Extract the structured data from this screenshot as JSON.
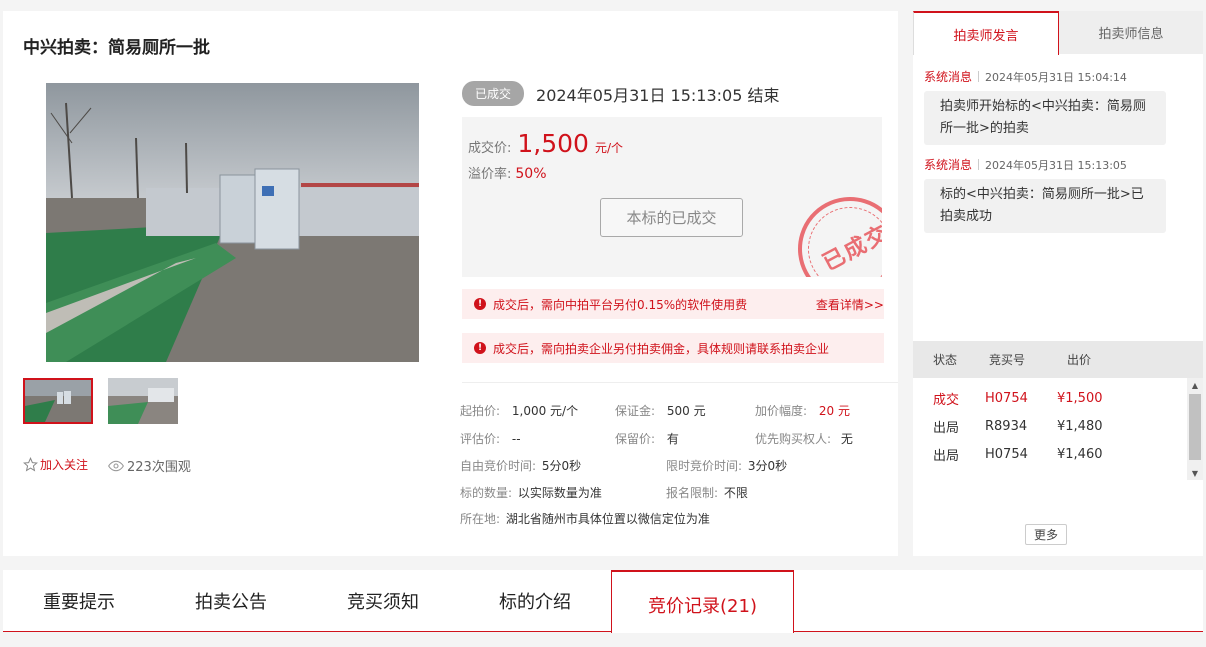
{
  "title": "中兴拍卖：简易厕所一批",
  "status": {
    "badge": "已成交",
    "end_time": "2024年05月31日 15:13:05 结束"
  },
  "price": {
    "deal_label": "成交价:",
    "deal_value": "1,500",
    "deal_unit": "元/个",
    "premium_label": "溢价率:",
    "premium_value": "50%",
    "sold_button": "本标的已成交",
    "stamp": "已成交"
  },
  "notices": [
    {
      "text": "成交后，需向中拍平台另付0.15%的软件使用费",
      "link": "查看详情>>"
    },
    {
      "text": "成交后，需向拍卖企业另付拍卖佣金，具体规则请联系拍卖企业",
      "link": ""
    }
  ],
  "info": {
    "start_price_label": "起拍价:",
    "start_price": "1,000 元/个",
    "deposit_label": "保证金:",
    "deposit": "500 元",
    "increment_label": "加价幅度:",
    "increment": "20 元",
    "estimate_label": "评估价:",
    "estimate": "--",
    "reserve_label": "保留价:",
    "reserve": "有",
    "priority_label": "优先购买权人:",
    "priority": "无",
    "free_time_label": "自由竞价时间:",
    "free_time": "5分0秒",
    "limit_time_label": "限时竞价时间:",
    "limit_time": "3分0秒",
    "quantity_label": "标的数量:",
    "quantity": "以实际数量为准",
    "signup_label": "报名限制:",
    "signup": "不限",
    "location_label": "所在地:",
    "location": "湖北省随州市具体位置以微信定位为准"
  },
  "follow_label": "加入关注",
  "views_label": "223次围观",
  "side": {
    "tabs": [
      "拍卖师发言",
      "拍卖师信息"
    ],
    "messages": [
      {
        "source": "系统消息",
        "time": "2024年05月31日  15:04:14",
        "body": "拍卖师开始标的<中兴拍卖：简易厕所一批>的拍卖"
      },
      {
        "source": "系统消息",
        "time": "2024年05月31日  15:13:05",
        "body": "标的<中兴拍卖：简易厕所一批>已拍卖成功"
      }
    ],
    "bid_headers": [
      "状态",
      "竞买号",
      "出价"
    ],
    "bids": [
      {
        "status": "成交",
        "number": "H0754",
        "price": "¥1,500"
      },
      {
        "status": "出局",
        "number": "R8934",
        "price": "¥1,480"
      },
      {
        "status": "出局",
        "number": "H0754",
        "price": "¥1,460"
      }
    ],
    "more_label": "更多"
  },
  "tabs": [
    "重要提示",
    "拍卖公告",
    "竞买须知",
    "标的介绍",
    "竞价记录(21)"
  ],
  "colors": {
    "accent": "#d0121b",
    "badge": "#a6a6a6",
    "notice_bg": "#fdeeee"
  }
}
